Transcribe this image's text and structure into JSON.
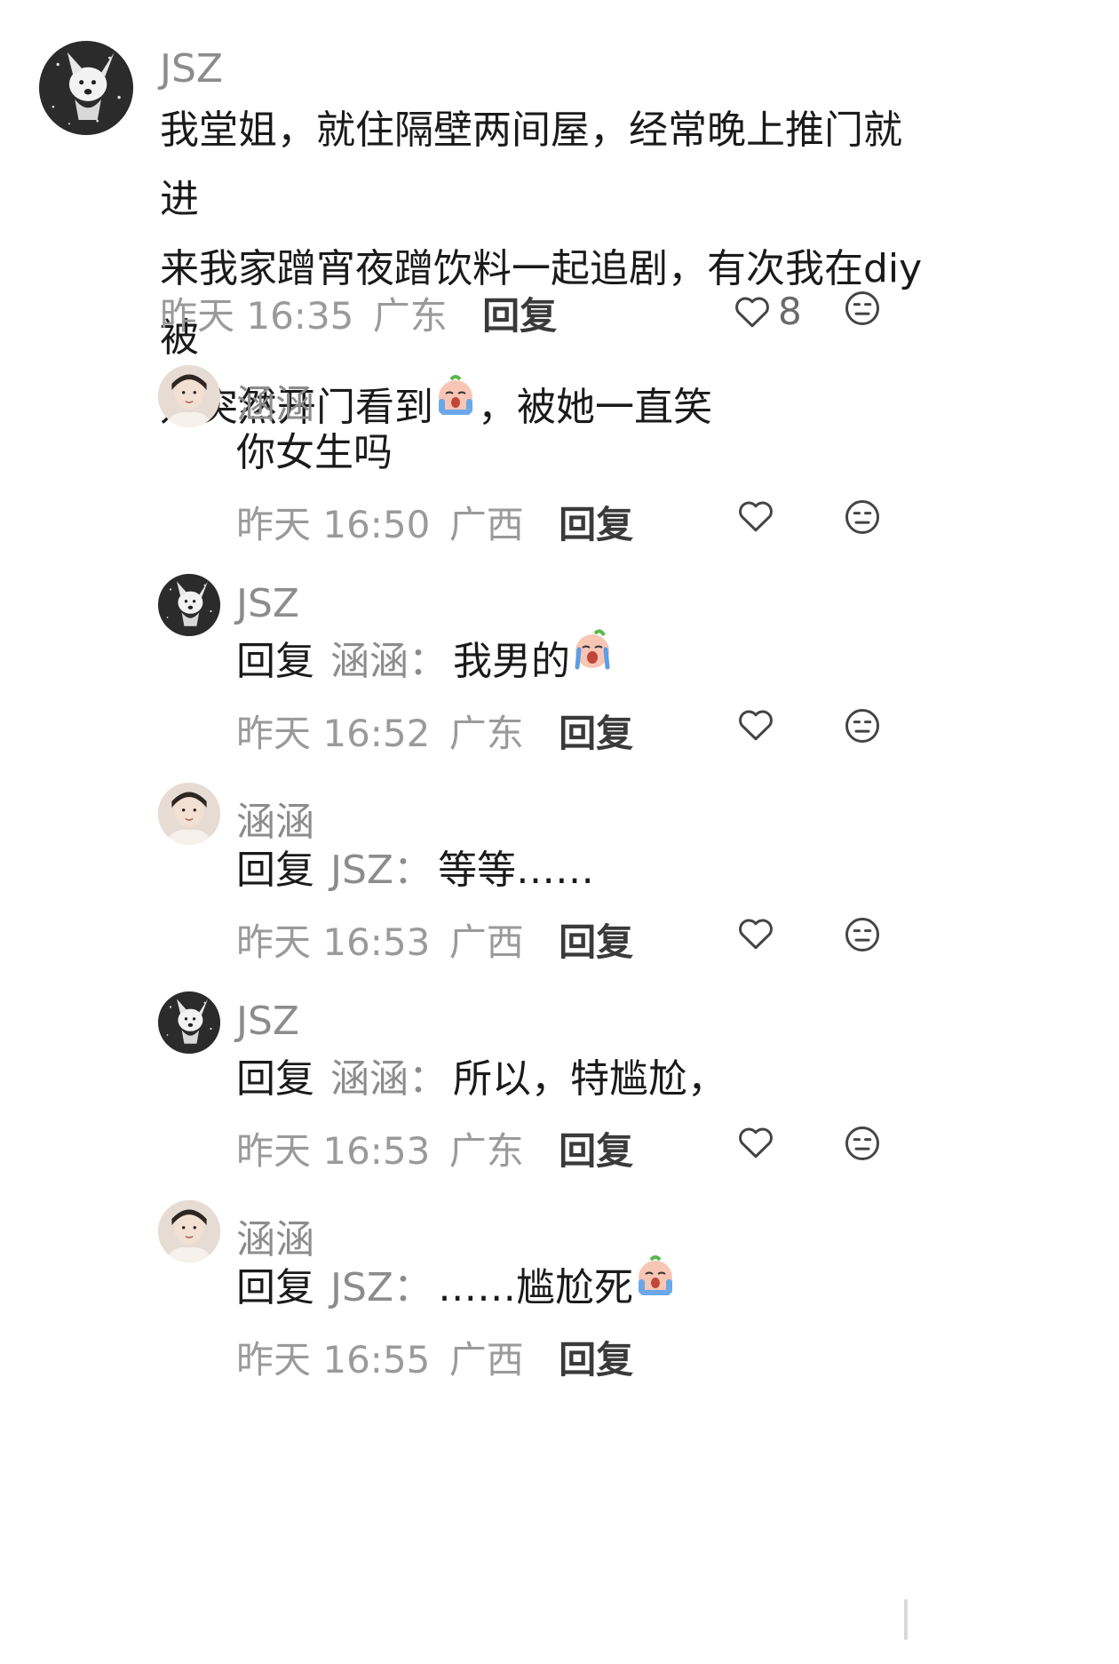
{
  "main_comment": {
    "user": "JSZ",
    "text_lines": [
      "我堂姐，就住隔壁两间屋，经常晚上推门就进",
      "来我家蹭宵夜蹭饮料一起追剧，有次我在diy被"
    ],
    "text_line3_a": "她突然开门看到",
    "text_line3_b": "，被她一直笑",
    "time": "昨天 16:35",
    "location": "广东",
    "reply_label": "回复",
    "likes": "8",
    "avatar": "dog-avatar"
  },
  "replies": [
    {
      "user": "涵涵",
      "avatar": "girl-avatar",
      "text": "你女生吗",
      "time": "昨天 16:50",
      "location": "广西",
      "reply_label": "回复"
    },
    {
      "user": "JSZ",
      "avatar": "dog-avatar",
      "reply_prefix": "回复",
      "reply_to": "涵涵：",
      "text": "我男的",
      "time": "昨天 16:52",
      "location": "广东",
      "reply_label": "回复"
    },
    {
      "user": "涵涵",
      "avatar": "girl-avatar",
      "reply_prefix": "回复",
      "reply_to": "JSZ：",
      "text": "等等……",
      "time": "昨天 16:53",
      "location": "广西",
      "reply_label": "回复"
    },
    {
      "user": "JSZ",
      "avatar": "dog-avatar",
      "reply_prefix": "回复",
      "reply_to": "涵涵：",
      "text": "所以，特尴尬，",
      "time": "昨天 16:53",
      "location": "广东",
      "reply_label": "回复"
    },
    {
      "user": "涵涵",
      "avatar": "girl-avatar",
      "reply_prefix": "回复",
      "reply_to": "JSZ：",
      "text": "……尴尬死",
      "time": "昨天 16:55",
      "location": "广西",
      "reply_label": "回复"
    }
  ],
  "icons": {
    "like": "heart-outline-icon",
    "dislike": "neutral-face-icon",
    "emoji_cry": "crying-emoji-icon"
  }
}
